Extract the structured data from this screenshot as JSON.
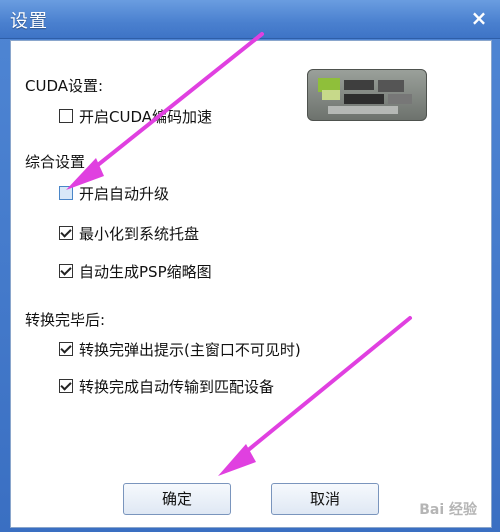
{
  "window": {
    "title": "设置",
    "close_glyph": "×"
  },
  "cuda": {
    "section_label": "CUDA设置:",
    "enable_cuda_label": "开启CUDA编码加速",
    "enable_cuda_checked": false
  },
  "general": {
    "section_label": "综合设置",
    "auto_upgrade_label": "开启自动升级",
    "auto_upgrade_checked": false,
    "minimize_tray_label": "最小化到系统托盘",
    "minimize_tray_checked": true,
    "psp_thumb_label": "自动生成PSP缩略图",
    "psp_thumb_checked": true
  },
  "after_convert": {
    "section_label": "转换完毕后:",
    "popup_label": "转换完弹出提示(主窗口不可见时)",
    "popup_checked": true,
    "transfer_label": "转换完成自动传输到匹配设备",
    "transfer_checked": true
  },
  "buttons": {
    "ok": "确定",
    "cancel": "取消"
  },
  "colors": {
    "arrow": "#e040e0",
    "titlebar": "#4a80cf"
  },
  "watermark": "Bai 经验"
}
